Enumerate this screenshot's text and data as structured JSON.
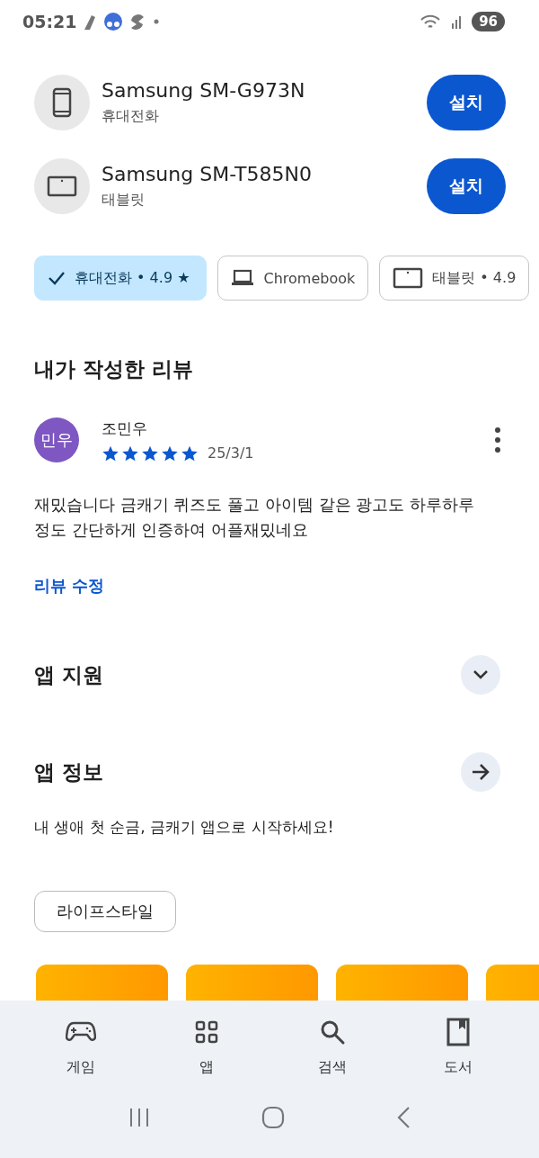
{
  "status_bar": {
    "time": "05:21",
    "battery": "96"
  },
  "devices": [
    {
      "name": "Samsung SM-G973N",
      "type_label": "휴대전화",
      "kind": "phone",
      "button": "설치"
    },
    {
      "name": "Samsung SM-T585N0",
      "type_label": "태블릿",
      "kind": "tablet",
      "button": "설치"
    }
  ],
  "device_chips": [
    {
      "label": "휴대전화 • 4.9 ★",
      "selected": true
    },
    {
      "label": "Chromebook",
      "kind": "laptop",
      "selected": false
    },
    {
      "label": "태블릿 • 4.9",
      "kind": "tablet",
      "selected": false
    }
  ],
  "my_review": {
    "heading": "내가 작성한 리뷰",
    "avatar": "민우",
    "author": "조민우",
    "stars": 5,
    "date": "25/3/1",
    "text": "재밌습니다 금캐기 퀴즈도 풀고 아이템 같은 광고도 하루하루 정도 간단하게 인증하여 어플재밌네요",
    "edit_link": "리뷰 수정"
  },
  "app_support": {
    "title": "앱 지원",
    "expanded": false
  },
  "app_info": {
    "title": "앱 정보",
    "description": "내 생애 첫 순금, 금캐기 앱으로 시작하세요!",
    "category": "라이프스타일"
  },
  "bottom_nav": [
    {
      "label": "게임",
      "kind": "games"
    },
    {
      "label": "앱",
      "kind": "apps"
    },
    {
      "label": "검색",
      "kind": "search"
    },
    {
      "label": "도서",
      "kind": "books"
    }
  ]
}
